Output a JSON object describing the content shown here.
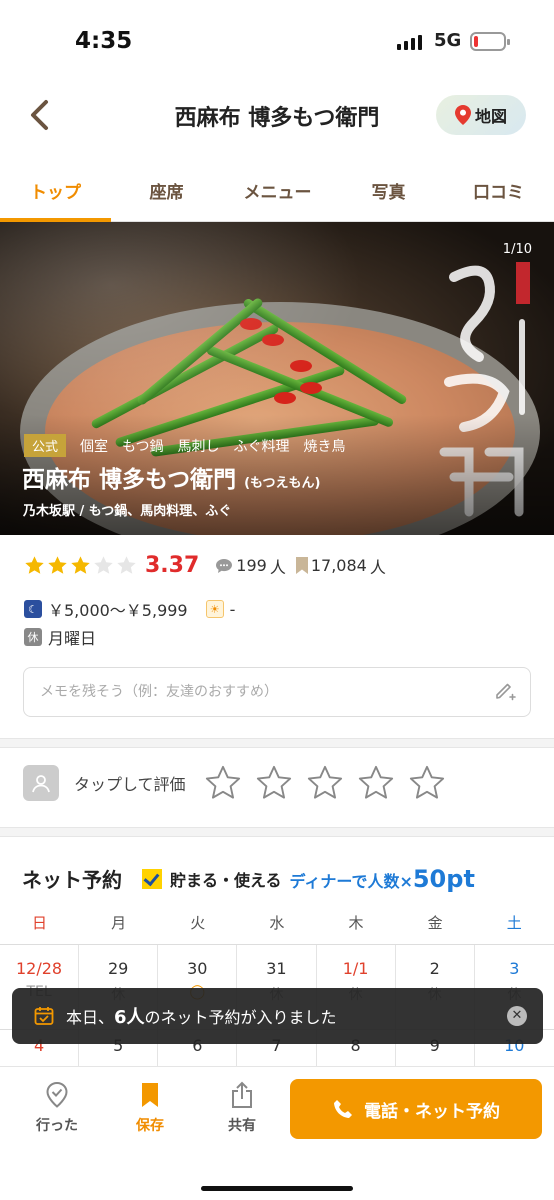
{
  "status_bar": {
    "time": "4:35",
    "network": "5G"
  },
  "nav": {
    "title": "西麻布 博多もつ衛門",
    "map_label": "地図"
  },
  "tabs": [
    {
      "label": "トップ",
      "active": true
    },
    {
      "label": "座席"
    },
    {
      "label": "メニュー"
    },
    {
      "label": "写真"
    },
    {
      "label": "口コミ"
    }
  ],
  "hero": {
    "pager": "1/10",
    "official_tag": "公式",
    "tags": [
      "個室",
      "もつ鍋",
      "馬刺し",
      "ふぐ料理",
      "焼き鳥"
    ],
    "name": "西麻布 博多もつ衛門",
    "reading": "(もつえもん)",
    "subtitle": "乃木坂駅 / もつ鍋、馬肉料理、ふぐ"
  },
  "rating": {
    "stars": 3,
    "score": "3.37",
    "reviews": "199",
    "reviews_unit": "人",
    "saves": "17,084",
    "saves_unit": "人"
  },
  "price": {
    "dinner": "￥5,000～￥5,999",
    "lunch": "-"
  },
  "holiday": {
    "icon_text": "休",
    "value": "月曜日"
  },
  "memo": {
    "placeholder": "メモを残そう（例：友達のおすすめ）"
  },
  "review_prompt": {
    "label": "タップして評価"
  },
  "reservation": {
    "title": "ネット予約",
    "save_text": "貯まる・使える",
    "promo_text": "ディナーで人数×",
    "promo_points": "50pt"
  },
  "calendar": {
    "weekdays": [
      "日",
      "月",
      "火",
      "水",
      "木",
      "金",
      "土"
    ],
    "row1": [
      {
        "day": "12/28",
        "mark": "TEL",
        "color": "#e0412c"
      },
      {
        "day": "29",
        "mark": "休",
        "color": "#333333"
      },
      {
        "day": "30",
        "mark": "◯",
        "color": "#333333"
      },
      {
        "day": "31",
        "mark": "休",
        "color": "#333333"
      },
      {
        "day": "1/1",
        "mark": "休",
        "color": "#e0412c"
      },
      {
        "day": "2",
        "mark": "休",
        "color": "#333333"
      },
      {
        "day": "3",
        "mark": "休",
        "color": "#1e7ad6"
      }
    ],
    "row2": [
      {
        "day": "4",
        "color": "#e0412c"
      },
      {
        "day": "5",
        "color": "#333333"
      },
      {
        "day": "6",
        "color": "#333333"
      },
      {
        "day": "7",
        "color": "#333333"
      },
      {
        "day": "8",
        "color": "#333333"
      },
      {
        "day": "9",
        "color": "#333333"
      },
      {
        "day": "10",
        "color": "#1e7ad6"
      }
    ]
  },
  "toast": {
    "prefix": "本日、",
    "count": "6人",
    "suffix": "のネット予約が入りました"
  },
  "bottom_bar": {
    "went": "行った",
    "save": "保存",
    "share": "共有",
    "call": "電話・ネット予約"
  },
  "colors": {
    "accent": "#f39800",
    "star": "#f5b800",
    "score": "#e02c2c",
    "link": "#1e7ad6"
  }
}
